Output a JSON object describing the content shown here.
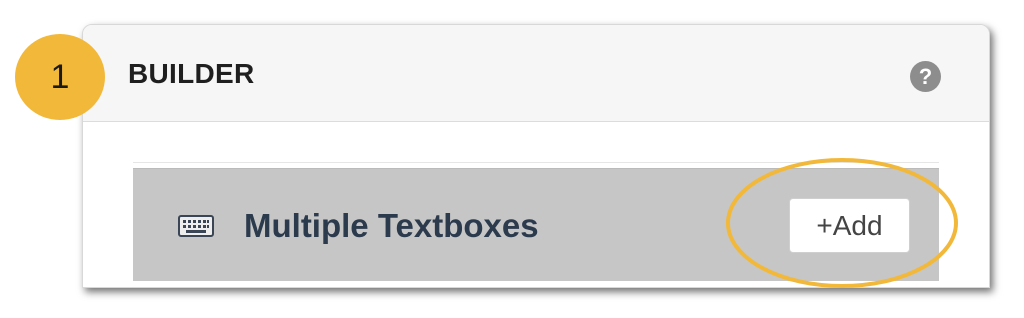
{
  "step_badge": "1",
  "builder": {
    "title": "BUILDER",
    "help_icon": "question-circle-icon",
    "help_glyph": "?"
  },
  "element": {
    "icon": "keyboard-icon",
    "label": "Multiple Textboxes",
    "add_label": "+Add"
  },
  "colors": {
    "accent": "#f2b83a",
    "row_background": "#c6c6c6",
    "label_text": "#2b3a4d"
  }
}
